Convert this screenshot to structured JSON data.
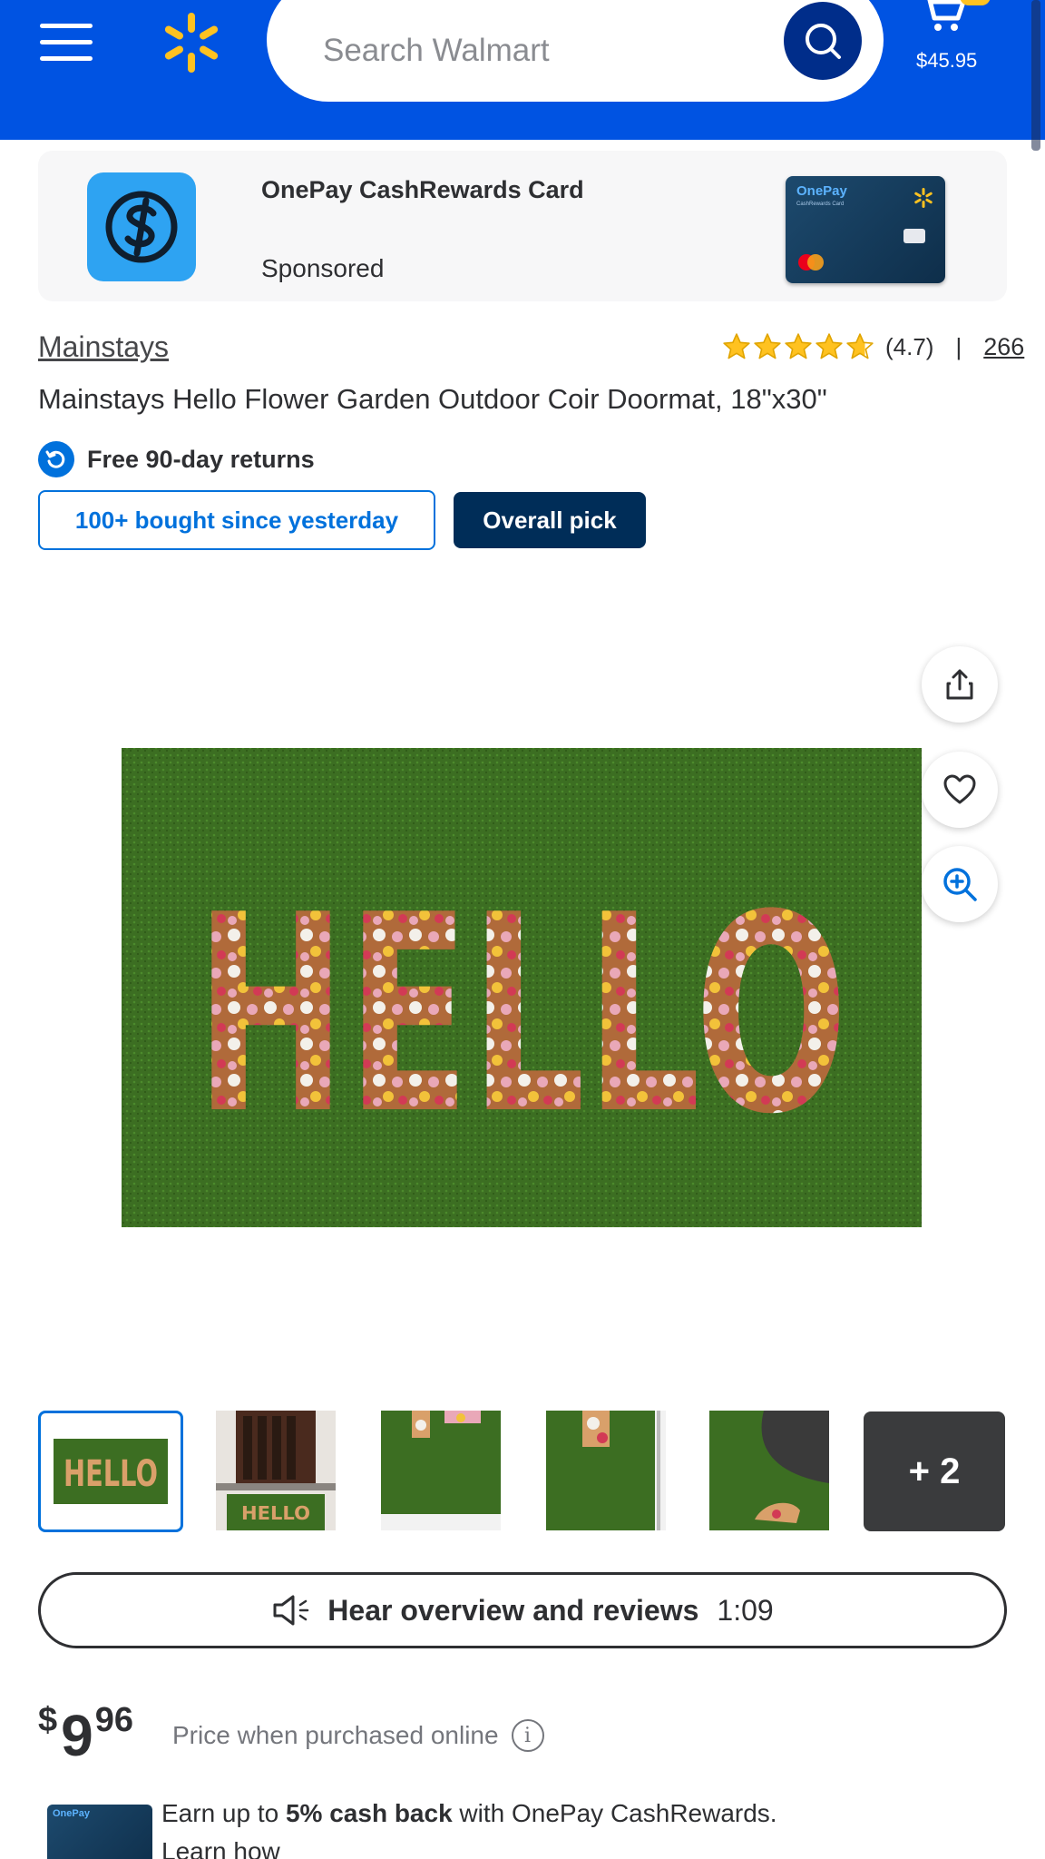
{
  "header": {
    "search_placeholder": "Search Walmart",
    "cart_total": "$45.95",
    "menu_icon": "hamburger-menu-icon",
    "logo_icon": "walmart-spark-icon",
    "search_icon": "search-icon",
    "cart_icon": "cart-icon"
  },
  "sponsored": {
    "title": "OnePay CashRewards Card",
    "label": "Sponsored",
    "card_brand": "OnePay",
    "card_subtext": "CashRewards Card"
  },
  "product": {
    "brand": "Mainstays",
    "rating_value": "(4.7)",
    "rating_stars": 4.7,
    "rating_separator": "|",
    "review_count": "266",
    "title": "Mainstays Hello Flower Garden Outdoor Coir Doormat, 18\"x30\"",
    "returns_text": "Free 90-day returns",
    "badge_bought": "100+ bought since yesterday",
    "badge_pick": "Overall pick",
    "image_word": "HELLO"
  },
  "gallery": {
    "more_count": "+ 2",
    "thumbnails": [
      "hello-mat-front",
      "hello-mat-at-door",
      "hello-mat-corner-detail",
      "hello-mat-closeup",
      "hello-mat-back-fold"
    ]
  },
  "audio": {
    "label": "Hear overview and reviews",
    "duration": "1:09"
  },
  "price": {
    "currency": "$",
    "dollars": "9",
    "cents": "96",
    "note": "Price when purchased online",
    "info": "i"
  },
  "cashback": {
    "prefix": "Earn up to ",
    "highlight": "5% cash back",
    "suffix": " with OnePay CashRewards.",
    "link": "Learn how"
  },
  "colors": {
    "brand_blue": "#0053e2",
    "spark_yellow": "#ffc220",
    "link_blue": "#0071dc",
    "dark_navy": "#002d58",
    "star_gold": "#ffc220",
    "mat_green": "#3a6b1f"
  }
}
